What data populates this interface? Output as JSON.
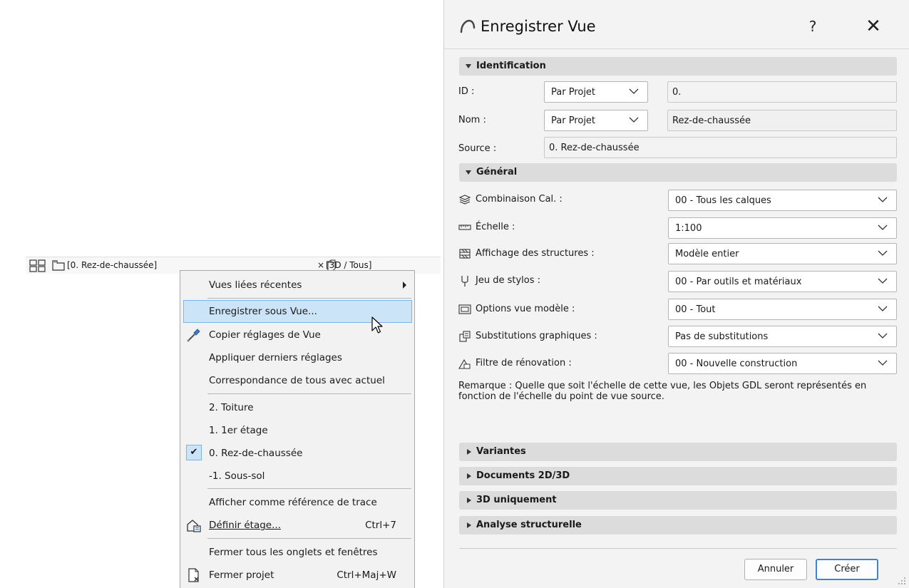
{
  "tabs": {
    "active_label": "[0. Rez-de-chaussée]",
    "close_glyph": "×",
    "second_label": "[3D / Tous]"
  },
  "context_menu": {
    "recent_views": "Vues liées récentes",
    "save_as_view": "Enregistrer sous Vue...",
    "copy_view_settings": "Copier réglages de Vue",
    "apply_last_settings": "Appliquer derniers réglages",
    "match_all": "Correspondance de tous avec actuel",
    "stories": [
      "2. Toiture",
      "1. 1er étage",
      "0. Rez-de-chaussée",
      "-1. Sous-sol"
    ],
    "checked_story_glyph": "✔",
    "show_as_trace": "Afficher comme référence de trace",
    "define_story": "Définir étage...",
    "define_story_shortcut": "Ctrl+7",
    "close_all_tabs": "Fermer tous les onglets et fenêtres",
    "close_project": "Fermer projet",
    "close_project_shortcut": "Ctrl+Maj+W"
  },
  "dialog": {
    "title": "Enregistrer Vue",
    "help_glyph": "?",
    "close_glyph": "✕",
    "identification": {
      "header": "Identification",
      "id_label": "ID :",
      "id_mode": "Par Projet",
      "id_value": "0.",
      "name_label": "Nom :",
      "name_mode": "Par Projet",
      "name_value": "Rez-de-chaussée",
      "source_label": "Source :",
      "source_value": "0. Rez-de-chaussée"
    },
    "general": {
      "header": "Général",
      "layer_combo_label": "Combinaison Cal. :",
      "layer_combo_value": "00 - Tous les calques",
      "scale_label": "Échelle :",
      "scale_value": "1:100",
      "structure_label": "Affichage des structures :",
      "structure_value": "Modèle entier",
      "penset_label": "Jeu de stylos :",
      "penset_value": "00 - Par outils et matériaux",
      "model_view_label": "Options vue modèle :",
      "model_view_value": "00 - Tout",
      "override_label": "Substitutions graphiques :",
      "override_value": "Pas de substitutions",
      "renovation_label": "Filtre de rénovation :",
      "renovation_value": "00 - Nouvelle construction",
      "remark_line1": "Remarque : Quelle que soit l'échelle de cette vue, les Objets GDL seront représentés en",
      "remark_line2": "fonction de l'échelle du point de vue source."
    },
    "collapsed_sections": [
      "Variantes",
      "Documents 2D/3D",
      "3D uniquement",
      "Analyse structurelle"
    ],
    "cancel_label": "Annuler",
    "create_label": "Créer"
  },
  "colors": {
    "highlight_bg": "#cce4f7",
    "highlight_border": "#7ab4e8",
    "primary_button_border": "#3a86d6"
  }
}
